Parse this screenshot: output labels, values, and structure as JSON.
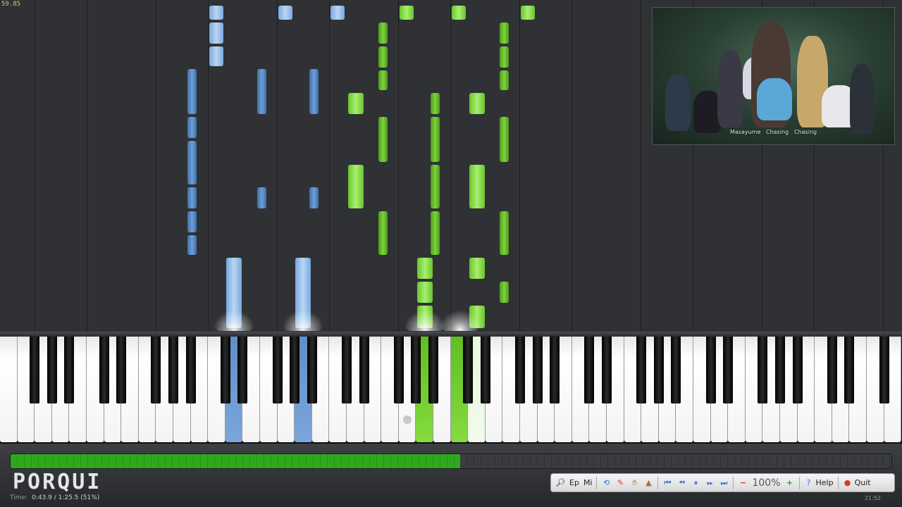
{
  "overlay": {
    "fps": "59.85"
  },
  "video_thumbnail": {
    "captions": [
      "Masayume",
      "Chasing",
      "Chasing"
    ]
  },
  "progress": {
    "fraction": 0.51
  },
  "branding": {
    "logo_text": "PORQUI"
  },
  "status": {
    "time_label": "Time:",
    "time_value": "0:43.9 / 1:25.5 (51%)",
    "clock": "21:52"
  },
  "toolbar": {
    "ep_label": "Ep",
    "mi_label": "Mi",
    "zoom_value": "100%",
    "help_label": "Help",
    "quit_label": "Quit"
  },
  "colors": {
    "left_hand": "#5b8ed0",
    "right_hand": "#74cc34",
    "progress": "#2fa81e",
    "quit_icon": "#d83a2a",
    "help_icon": "#2a6ad8"
  }
}
